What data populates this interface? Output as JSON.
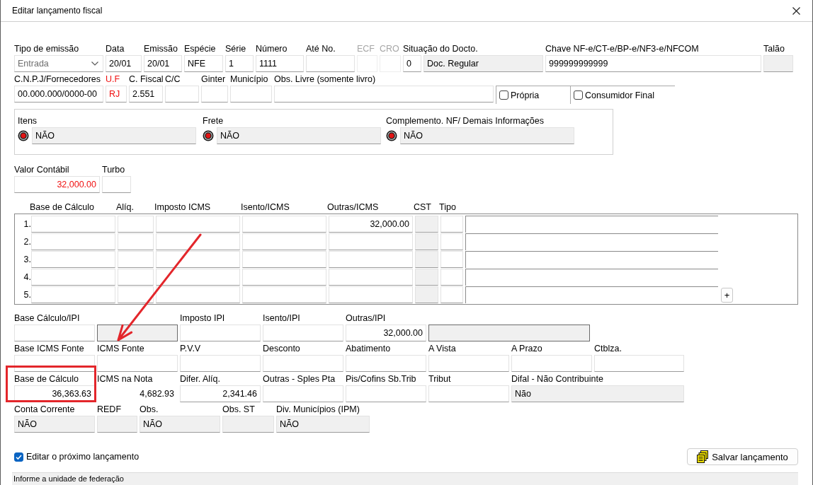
{
  "window": {
    "title": "Editar lançamento fiscal"
  },
  "header_row": [
    {
      "label": "Tipo de emissão",
      "kind": "combo",
      "value": "Entrada",
      "disabled": false
    },
    {
      "label": "Data",
      "kind": "edit",
      "value": "20/01",
      "disabled": false
    },
    {
      "label": "Emissão",
      "kind": "edit",
      "value": "20/01",
      "disabled": false
    },
    {
      "label": "Espécie",
      "kind": "edit",
      "value": "NFE",
      "disabled": false
    },
    {
      "label": "Série",
      "kind": "edit",
      "value": "1",
      "disabled": false
    },
    {
      "label": "Número",
      "kind": "edit",
      "value": "1111",
      "disabled": false
    },
    {
      "label": "Até No.",
      "kind": "edit",
      "disabled": false
    },
    {
      "label": "ECF",
      "kind": "edit",
      "disabled": true
    },
    {
      "label": "CRO",
      "kind": "edit",
      "disabled": true
    },
    {
      "label": "Situação do Docto.",
      "kind": "edit",
      "value": "0",
      "disabled": false
    },
    {
      "kind": "locked",
      "value": "Doc. Regular",
      "disabled": false
    },
    {
      "label": "Chave NF-e/CT-e/BP-e/NF3-e/NFCOM",
      "kind": "edit",
      "value": "999999999999",
      "disabled": false
    },
    {
      "label": "Talão",
      "kind": "locked",
      "disabled": false
    }
  ],
  "party_row": [
    {
      "label": "C.N.P.J/Fornecedores",
      "kind": "edit",
      "value": "00.000.000/0000-00",
      "error": false
    },
    {
      "label": "U.F",
      "kind": "edit",
      "value": "RJ",
      "error": true
    },
    {
      "label": "C. Fiscal",
      "kind": "edit",
      "value": "2.551",
      "error": false
    },
    {
      "label": "C/C",
      "kind": "edit",
      "error": false
    },
    {
      "label": "Ginter",
      "kind": "edit",
      "error": false
    },
    {
      "label": "Município",
      "kind": "edit",
      "error": false
    },
    {
      "label": "Obs. Livre (somente livro)",
      "kind": "edit",
      "error": false
    }
  ],
  "party_options": [
    {
      "label": "Própria",
      "checked": false
    },
    {
      "label": "Consumidor Final",
      "checked": false
    }
  ],
  "info_group": [
    {
      "label": "Itens",
      "value": "NÃO"
    },
    {
      "label": "Frete",
      "value": "NÃO"
    },
    {
      "label": "Complemento. NF/ Demais Informações",
      "value": "NÃO"
    }
  ],
  "totals_row": [
    {
      "label": "Valor Contábil",
      "kind": "number",
      "value": "32,000.00",
      "emphasis": true
    },
    {
      "label": "Turbo",
      "kind": "edit"
    }
  ],
  "icms_table": {
    "columns": [
      "Base de Cálculo",
      "Alíq.",
      "Imposto ICMS",
      "Isento/ICMS",
      "Outras/ICMS",
      "CST",
      "Tipo"
    ],
    "rows": [
      {
        "number": "1.",
        "cells": [
          {
            "kind": "edit"
          },
          {
            "kind": "edit"
          },
          {
            "kind": "edit"
          },
          {
            "kind": "edit"
          },
          {
            "kind": "number",
            "value": "32,000.00"
          },
          {
            "kind": "locked"
          },
          {
            "kind": "edit"
          },
          {
            "kind": "line"
          }
        ]
      },
      {
        "number": "2.",
        "cells": [
          {
            "kind": "edit"
          },
          {
            "kind": "edit"
          },
          {
            "kind": "edit"
          },
          {
            "kind": "edit"
          },
          {
            "kind": "edit"
          },
          {
            "kind": "locked"
          },
          {
            "kind": "edit"
          },
          {
            "kind": "line"
          }
        ]
      },
      {
        "number": "3.",
        "cells": [
          {
            "kind": "edit"
          },
          {
            "kind": "edit"
          },
          {
            "kind": "edit"
          },
          {
            "kind": "edit"
          },
          {
            "kind": "edit"
          },
          {
            "kind": "locked"
          },
          {
            "kind": "edit"
          },
          {
            "kind": "line"
          }
        ]
      },
      {
        "number": "4.",
        "cells": [
          {
            "kind": "edit"
          },
          {
            "kind": "edit"
          },
          {
            "kind": "edit"
          },
          {
            "kind": "edit"
          },
          {
            "kind": "edit"
          },
          {
            "kind": "locked"
          },
          {
            "kind": "edit"
          },
          {
            "kind": "line"
          }
        ]
      },
      {
        "number": "5.",
        "cells": [
          {
            "kind": "edit"
          },
          {
            "kind": "edit"
          },
          {
            "kind": "edit"
          },
          {
            "kind": "edit"
          },
          {
            "kind": "edit"
          },
          {
            "kind": "locked"
          },
          {
            "kind": "edit"
          },
          {
            "kind": "line"
          }
        ]
      }
    ],
    "add_button": "+"
  },
  "summary_rows": [
    [
      {
        "label": "Base Cálculo/IPI",
        "kind": "edit"
      },
      {
        "kind": "frame"
      },
      {
        "label": "Imposto IPI",
        "kind": "edit"
      },
      {
        "label": "Isento/IPI",
        "kind": "edit"
      },
      {
        "label": "Outras/IPI",
        "kind": "number",
        "value": "32,000.00"
      },
      {
        "kind": "frame"
      }
    ],
    [
      {
        "label": "Base ICMS Fonte",
        "kind": "edit"
      },
      {
        "label": "ICMS Fonte",
        "kind": "edit"
      },
      {
        "label": "P.V.V",
        "kind": "edit"
      },
      {
        "label": "Desconto",
        "kind": "edit"
      },
      {
        "label": "Abatimento",
        "kind": "edit"
      },
      {
        "label": "A Vista",
        "kind": "edit"
      },
      {
        "label": "A Prazo",
        "kind": "edit"
      },
      {
        "label": "Ctblza.",
        "kind": "edit"
      }
    ],
    [
      {
        "label": "Base de Cálculo",
        "kind": "number",
        "value": "36,363.63"
      },
      {
        "label": "ICMS na Nota",
        "kind": "plain",
        "value": "4,682.93"
      },
      {
        "label": "Difer. Alíq.",
        "kind": "number",
        "value": "2,341.46"
      },
      {
        "label": "Outras - Sples Pta",
        "kind": "edit"
      },
      {
        "label": "Pis/Cofins Sb.Trib",
        "kind": "edit"
      },
      {
        "label": "Tribut",
        "kind": "edit"
      },
      {
        "label": "Difal - Não Contribuinte",
        "kind": "locked",
        "value": "Não"
      }
    ],
    [
      {
        "label": "Conta Corrente",
        "kind": "locked",
        "value": "NÃO"
      },
      {
        "label": "REDF",
        "kind": "locked"
      },
      {
        "label": "Obs.",
        "kind": "locked",
        "value": "NÃO"
      },
      {
        "label": "Obs. ST",
        "kind": "locked"
      },
      {
        "label": "Div. Municípios (IPM)",
        "kind": "locked",
        "value": "NÃO"
      }
    ]
  ],
  "next_entry": {
    "label": "Editar o próximo lançamento",
    "checked": true
  },
  "save_button": {
    "label": "Salvar lançamento"
  },
  "status_bar": "Informe a unidade de federação"
}
